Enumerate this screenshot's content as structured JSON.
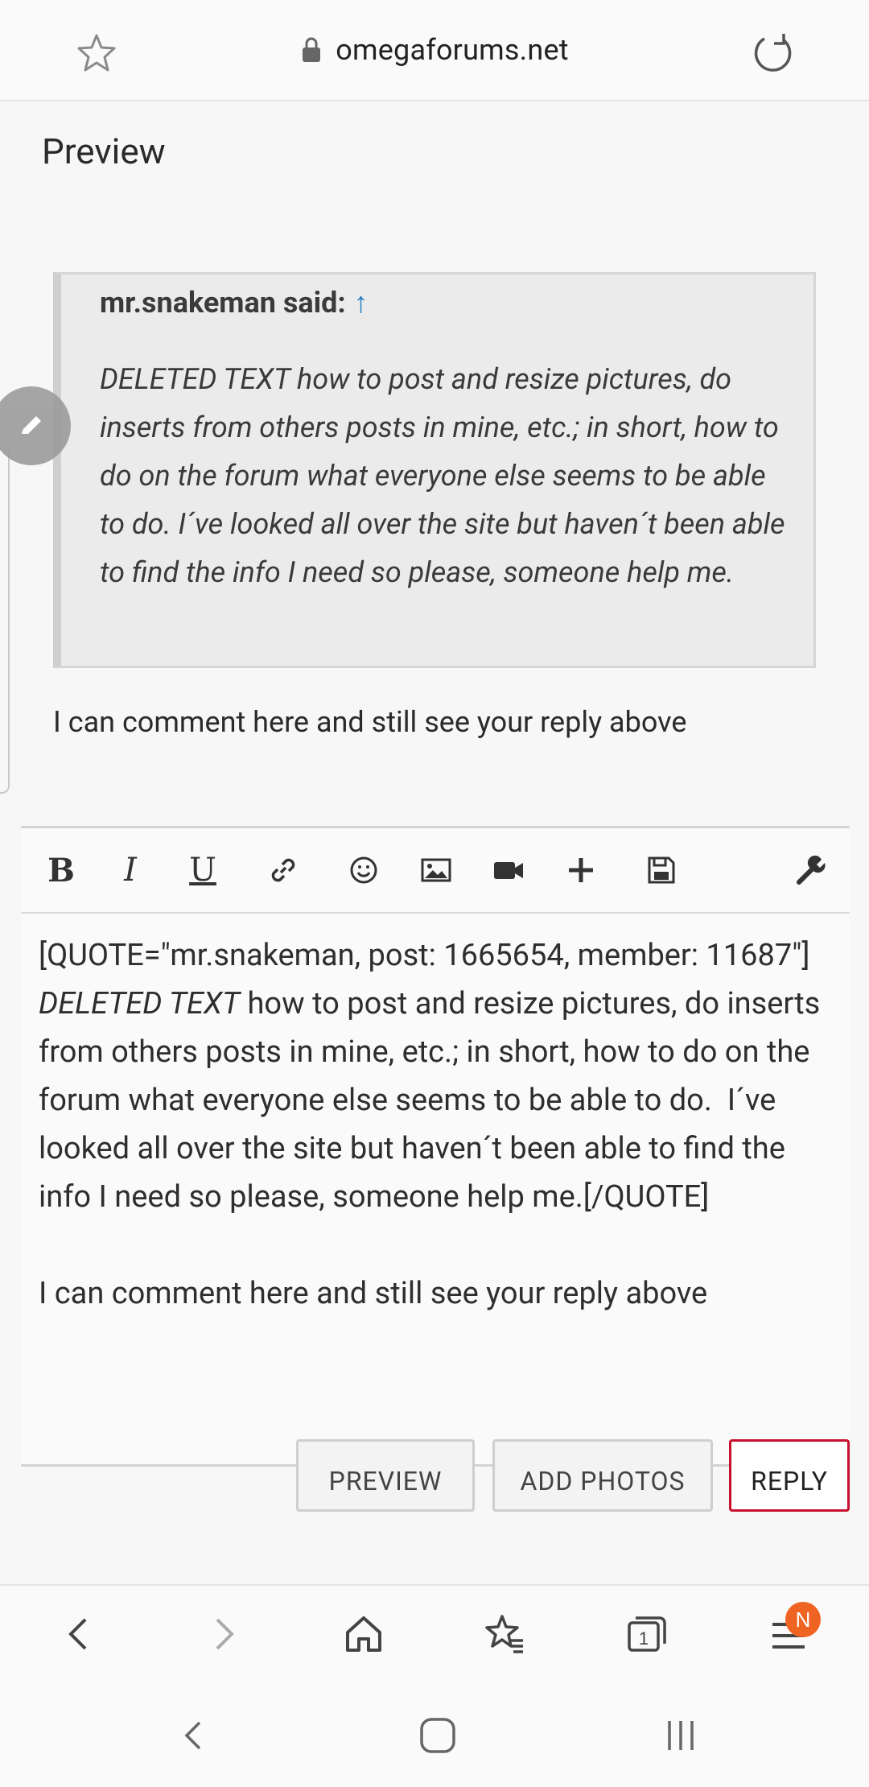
{
  "browser": {
    "url": "omegaforums.net",
    "icons": [
      "star-icon",
      "lock-icon",
      "reload-icon"
    ]
  },
  "page": {
    "preview_title": "Preview",
    "quote": {
      "author": "mr.snakeman said:",
      "arrow": "↑",
      "text_italic_lead": "DELETED TEXT",
      "text": " how to post and resize pictures, do inserts from others posts in mine, etc.; in short, how to do on the forum what everyone else seems to be able to do. I´ve looked all over the site but haven´t been able to find the info I need so please, someone help me."
    },
    "comment": "I can comment here and still see your reply above"
  },
  "editor": {
    "toolbar": {
      "bold": "B",
      "italic": "I",
      "underline": "U",
      "icons": [
        "link-icon",
        "smiley-icon",
        "image-icon",
        "video-icon",
        "plus-icon",
        "save-icon",
        "wrench-icon"
      ]
    },
    "content_prefix": "[QUOTE=\"mr.snakeman, post: 1665654, member: 11687\"]    ",
    "content_italic": "DELETED TEXT",
    "content_body": " how to post and resize pictures, do inserts from others posts in mine, etc.; in short, how to do on the forum what everyone else seems to be able to do.  I´ve looked all over the site but haven´t been able to find the info I need so please, someone help me.[/QUOTE]",
    "content_comment": "I can comment here and still see your reply above"
  },
  "buttons": {
    "preview": "PREVIEW",
    "add_photos": "ADD PHOTOS",
    "reply": "REPLY"
  },
  "bottom_nav": {
    "badge": "N",
    "icons": [
      "back-icon",
      "forward-icon",
      "home-icon",
      "bookmarks-icon",
      "tabs-icon",
      "menu-icon"
    ],
    "tabs_count": "1"
  },
  "system_nav": {
    "icons": [
      "system-back-icon",
      "system-home-icon",
      "system-recents-icon"
    ]
  },
  "colors": {
    "reply_border": "#c8102e",
    "quote_arrow": "#2a7fc0",
    "badge": "#f06423"
  }
}
